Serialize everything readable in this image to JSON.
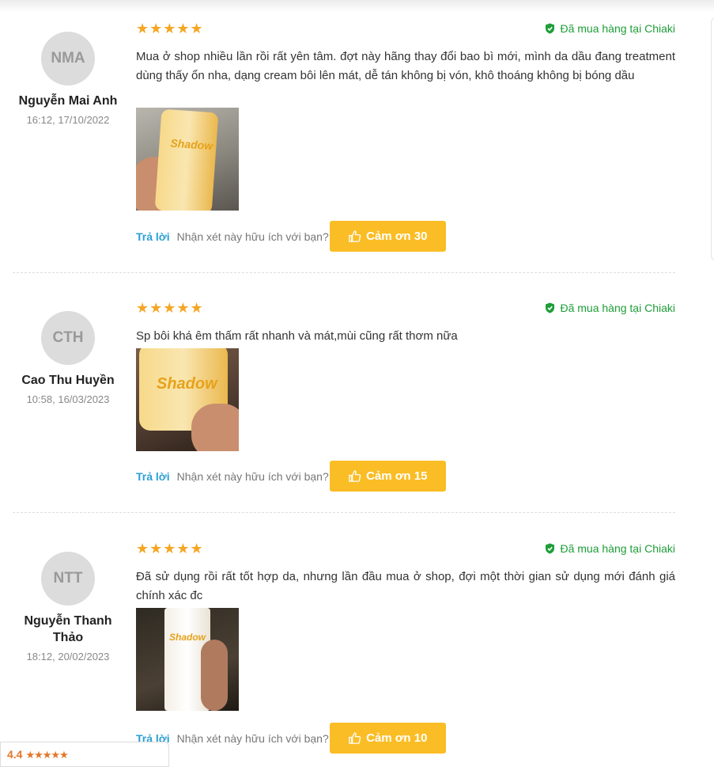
{
  "reviews": [
    {
      "initials": "NMA",
      "name": "Nguyễn Mai Anh",
      "time": "16:12, 17/10/2022",
      "stars": "★★★★★",
      "rating": 5,
      "verified": "Đã mua hàng tại Chiaki",
      "text": "Mua ở shop nhiều lần rồi rất yên tâm. đợt này hãng thay đổi bao bì mới, mình da dầu đang treatment dùng thấy ổn nha, dạng cream bôi lên mát, dễ tán không bị vón, khô thoáng không bị bóng dầu",
      "image_label": "Shadow",
      "reply": "Trả lời",
      "helpful_question": "Nhận xét này hữu ích với bạn?",
      "thanks": "Cảm ơn 30"
    },
    {
      "initials": "CTH",
      "name": "Cao Thu Huyền",
      "time": "10:58, 16/03/2023",
      "stars": "★★★★★",
      "rating": 5,
      "verified": "Đã mua hàng tại Chiaki",
      "text": "Sp bôi khá êm thấm rất nhanh và mát,mùi cũng rất thơm nữa",
      "image_label": "Shadow",
      "reply": "Trả lời",
      "helpful_question": "Nhận xét này hữu ích với bạn?",
      "thanks": "Cảm ơn 15"
    },
    {
      "initials": "NTT",
      "name": "Nguyễn Thanh Thảo",
      "time": "18:12, 20/02/2023",
      "stars": "★★★★★",
      "rating": 5,
      "verified": "Đã mua hàng tại Chiaki",
      "text": "Đã sử dụng rồi rất tốt hợp da, nhưng lần đầu mua ở shop, đợi một thời gian sử dụng mới đánh giá chính xác đc",
      "image_label": "Shadow",
      "reply": "Trả lời",
      "helpful_question": "Nhận xét này hữu ích với bạn?",
      "thanks": "Cảm ơn 10"
    }
  ],
  "rating_widget": {
    "value": "4.4",
    "stars": "★★★★★"
  },
  "colors": {
    "star": "#f5a623",
    "verified": "#1e9e38",
    "reply_link": "#2a9fd6",
    "thanks_button": "#fbbd25"
  },
  "icons": {
    "verified": "shield-check-icon",
    "thanks": "thumbs-up-icon"
  }
}
